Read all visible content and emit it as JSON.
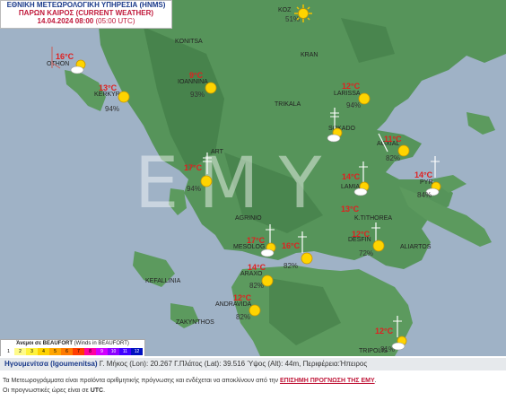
{
  "header": {
    "line1": "ΕΘΝΙΚΗ ΜΕΤΕΩΡΟΛΟΓΙΚΗ ΥΠΗΡΕΣΙΑ (HNMS)",
    "line2": "ΠΑΡΩΝ ΚΑΙΡΟΣ (CURRENT WEATHER)",
    "line3_date": "14.04.2024 08:00",
    "line3_utc": "(05:00 UTC)"
  },
  "watermark": "ΕΜΥ",
  "colors": {
    "sea": "#9fb2c6",
    "land": "#56945a",
    "temp": "#e02020",
    "title_blue": "#1a3a8a",
    "title_red": "#c0183a"
  },
  "places": [
    {
      "name": "KOZANI",
      "short": "KOZ"
    },
    {
      "name": "KONITSA"
    },
    {
      "name": "KRAN"
    },
    {
      "name": "OTHONOI",
      "short": "OTHON"
    },
    {
      "name": "KERKYRA",
      "short": "KERKYR"
    },
    {
      "name": "IOANNINA"
    },
    {
      "name": "LARISSA"
    },
    {
      "name": "TRIKALA"
    },
    {
      "name": "SOKADO"
    },
    {
      "name": "AGXIALOS",
      "short": "AGXIAL"
    },
    {
      "name": "ARTA",
      "short": "ART"
    },
    {
      "name": "AGRINIO"
    },
    {
      "name": "LAMIA"
    },
    {
      "name": "SKYROS",
      "short": "PYR"
    },
    {
      "name": "K.TITHOREA"
    },
    {
      "name": "DESFINA",
      "short": "DESFIN"
    },
    {
      "name": "ALIARTOS"
    },
    {
      "name": "MESOLOGGI",
      "short": "MESOLOG"
    },
    {
      "name": "ARAXOS",
      "short": "ARAXO"
    },
    {
      "name": "KEFALLINIA"
    },
    {
      "name": "ANDRAVIDA"
    },
    {
      "name": "ZAKYNTHOS"
    },
    {
      "name": "TRIPOLIS"
    }
  ],
  "stations": [
    {
      "temp": "",
      "hum": "51%"
    },
    {
      "temp": "16°C",
      "hum": ""
    },
    {
      "temp": "13°C",
      "hum": "94%"
    },
    {
      "temp": "9°C",
      "hum": "93%"
    },
    {
      "temp": "12°C",
      "hum": "94%"
    },
    {
      "temp": "11°C",
      "hum": ""
    },
    {
      "temp": "14°C",
      "hum": "82%"
    },
    {
      "temp": "17°C",
      "hum": "94%"
    },
    {
      "temp": "14°C",
      "hum": ""
    },
    {
      "temp": "13°C",
      "hum": "84%"
    },
    {
      "temp": "12°C",
      "hum": "72%"
    },
    {
      "temp": "17°C",
      "hum": ""
    },
    {
      "temp": "16°C",
      "hum": "82%"
    },
    {
      "temp": "14°C",
      "hum": "82%"
    },
    {
      "temp": "12°C",
      "hum": "82%"
    },
    {
      "temp": "12°C",
      "hum": "81%"
    }
  ],
  "beaufort": {
    "title": "Άνεμοι σε BEAUFORT",
    "title_en": "(Winds in BEAUFORT)",
    "levels": [
      "1",
      "2",
      "3",
      "4",
      "5",
      "6",
      "7",
      "8",
      "9",
      "10",
      "11",
      "12"
    ],
    "level_colors": [
      "#ffffff",
      "#fffb8a",
      "#fff23c",
      "#ffd200",
      "#ffa500",
      "#ff7a00",
      "#ff3c00",
      "#ff00a0",
      "#d000ff",
      "#8a00ff",
      "#4000ff",
      "#0010c0"
    ]
  },
  "info": {
    "location": "Ηγουμενίτσα (Igoumenitsa)",
    "lon_label": "Γ. Μήκος (Lon):",
    "lon": "20.267",
    "lat_label": "Γ.Πλάτος (Lat):",
    "lat": "39.516",
    "alt_label": "Ύψος (Alt):",
    "alt": "44m,",
    "region_label": "Περιφέρεια:",
    "region": "Ήπειρος"
  },
  "footer": {
    "line1_pre": "Τα Μετεωρογράμματα είναι προϊόντα αριθμητικής πρόγνωσης και ενδέχεται να αποκλίνουν από την",
    "line1_link": "ΕΠΙΣΗΜΗ ΠΡΟΓΝΩΣΗ ΤΗΣ ΕΜΥ",
    "line1_post": ".",
    "line2_pre": "Οι προγνωστικές ώρες είναι σε",
    "line2_bold": "UTC",
    "line2_post": "."
  }
}
